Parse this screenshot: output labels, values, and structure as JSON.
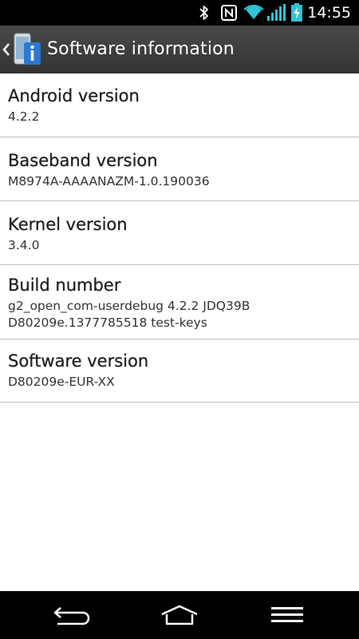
{
  "status_bar": {
    "time": "14:55",
    "icons": [
      "bluetooth-icon",
      "nfc-icon",
      "wifi-icon",
      "signal-icon",
      "battery-charging-icon"
    ]
  },
  "action_bar": {
    "title": "Software information",
    "back_icon": "chevron-left-icon",
    "app_icon": "phone-info-icon"
  },
  "items": [
    {
      "title": "Android version",
      "value": "4.2.2"
    },
    {
      "title": "Baseband version",
      "value": "M8974A-AAAANAZM-1.0.190036"
    },
    {
      "title": "Kernel version",
      "value": "3.4.0"
    },
    {
      "title": "Build number",
      "value": "g2_open_com-userdebug 4.2.2 JDQ39B\nD80209e.1377785518 test-keys"
    },
    {
      "title": "Software version",
      "value": "D80209e-EUR-XX"
    }
  ],
  "nav_bar": {
    "buttons": [
      "back-icon",
      "home-icon",
      "menu-icon"
    ]
  },
  "colors": {
    "status_bar_bg": "#000000",
    "action_bar_bg": "#3c3c3c",
    "accent_wifi": "#2fc3d6",
    "divider": "#bdbdbd"
  }
}
